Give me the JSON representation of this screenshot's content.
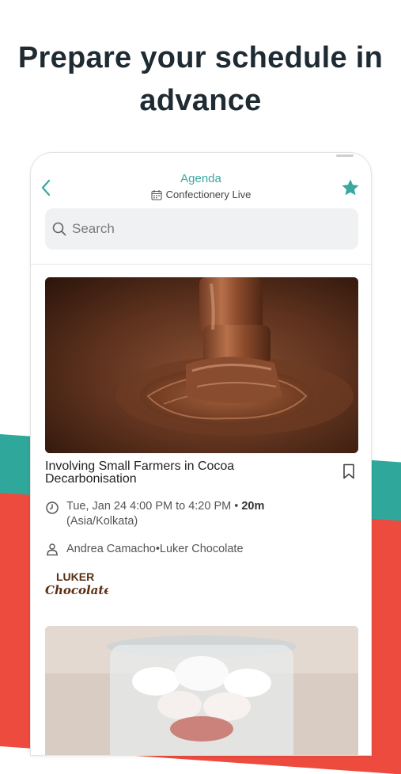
{
  "promo": {
    "headline_line1": "Prepare your schedule in",
    "headline_line2": "advance"
  },
  "colors": {
    "accent": "#3aa7a0",
    "teal_band": "#2fa89b",
    "red_band": "#ee4b3f",
    "headline": "#1e2b33"
  },
  "header": {
    "title": "Agenda",
    "event_name": "Confectionery Live",
    "back_icon": "chevron-left-icon",
    "favorite_icon": "star-icon",
    "calendar_icon": "calendar-icon"
  },
  "search": {
    "placeholder": "Search",
    "value": ""
  },
  "sessions": [
    {
      "title": "Involving Small Farmers in Cocoa Decarbonisation",
      "time_line1": "Tue, Jan 24 4:00 PM to 4:20 PM",
      "separator": " • ",
      "duration": "20m",
      "timezone": "(Asia/Kolkata)",
      "speaker": "Andrea Camacho",
      "company": "Luker Chocolate",
      "logo_text_top": "LUKER",
      "logo_text_bottom": "Chocolate",
      "image_desc": "melted chocolate",
      "bookmark_icon": "bookmark-icon",
      "clock_icon": "clock-icon",
      "speaker_icon": "speaker-icon"
    }
  ]
}
